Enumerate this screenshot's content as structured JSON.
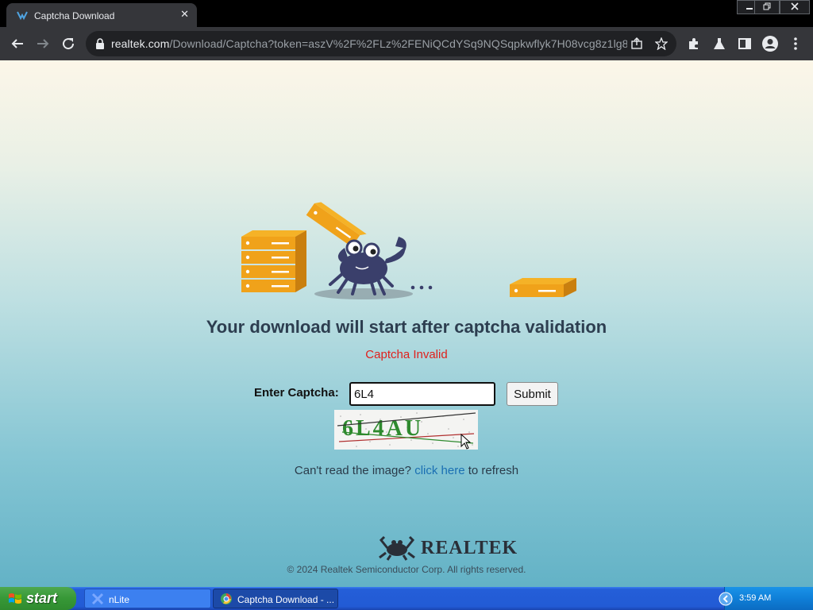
{
  "browser": {
    "tab_title": "Captcha Download",
    "tab_close": "✕",
    "url_host": "realtek.com",
    "url_path": "/Download/Captcha?token=aszV%2F%2FLz%2FENiQCdYSq9NQSqpkwflyk7H08vcg8z1lg8..."
  },
  "page": {
    "headline": "Your download will start after captcha validation",
    "error": "Captcha Invalid",
    "captcha_label": "Enter Captcha:",
    "captcha_value": "6L4",
    "submit_label": "Submit",
    "captcha_image_text": "6L4AU",
    "refresh_prefix": "Can't read the image?",
    "refresh_link": "click here",
    "refresh_suffix": "to refresh",
    "logo_text": "REALTEK",
    "copyright": "© 2024 Realtek Semiconductor Corp. All rights reserved."
  },
  "taskbar": {
    "start_label": "start",
    "tasks": [
      {
        "label": "nLite"
      },
      {
        "label": "Captcha Download - ..."
      }
    ],
    "clock": "3:59 AM"
  },
  "colors": {
    "error": "#e0201c",
    "link": "#1a6fb3",
    "headline": "#2d3e50"
  }
}
